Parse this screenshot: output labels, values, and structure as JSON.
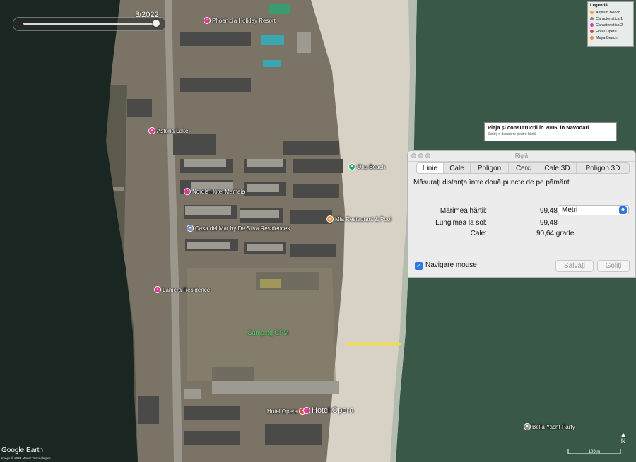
{
  "time_slider": {
    "label": "3/2022",
    "position": 0.95
  },
  "legend": {
    "title": "Legendă",
    "items": [
      {
        "label": "Asylum Beach",
        "color": "#f0a830"
      },
      {
        "label": "Caracteristica 1",
        "color": "#8a8a8a"
      },
      {
        "label": "Caracteristica 2",
        "color": "#d83fb5"
      },
      {
        "label": "Hotel Opera",
        "color": "#e0464d"
      },
      {
        "label": "Maya Beach",
        "color": "#f08a3a"
      }
    ]
  },
  "placemarks": [
    {
      "label": "Phoenicia Holiday Resort",
      "color": "#e0388f"
    },
    {
      "label": "Astoria Lake",
      "color": "#e0388f"
    },
    {
      "label": "Oha Beach",
      "color": "#29a36a"
    },
    {
      "label": "Nordis Hotel Mamaia",
      "color": "#e0388f"
    },
    {
      "label": "Mia Restaurant & Pool",
      "color": "#f08a3a"
    },
    {
      "label": "Casa del Mar by De Silva Residences",
      "color": "#6e87b8"
    },
    {
      "label": "Lamera Residence",
      "color": "#e0388f"
    },
    {
      "label": "Camping CPM",
      "color": "#4cdd6a"
    },
    {
      "label": "Hotel Opera",
      "color": "#e0464d"
    },
    {
      "label": "Hotel Opera",
      "color": "#e0388f"
    },
    {
      "label": "Bella Yacht Party",
      "color": "#8a8a8a"
    }
  ],
  "popup": {
    "title": "Plaja și consutrucții în 2006, în Navodari",
    "description": "Scrieți o descriere pentru hărții."
  },
  "ruler": {
    "window_title": "Riglă",
    "tabs": [
      "Linie",
      "Cale",
      "Poligon",
      "Cerc",
      "Cale 3D",
      "Poligon 3D"
    ],
    "active_tab": "Linie",
    "description": "Măsurați distanța între două puncte de pe pământ",
    "map_length_label": "Mărimea hărții:",
    "map_length_value": "99,48",
    "ground_length_label": "Lungimea la sol:",
    "ground_length_value": "99,48",
    "heading_label": "Cale:",
    "heading_value": "90,64 grade",
    "unit": "Metri",
    "mouse_nav_label": "Navigare mouse",
    "mouse_nav_checked": true,
    "save_label": "Salvați",
    "clear_label": "Goliți"
  },
  "footer": {
    "logo": "Google Earth",
    "credit": "Image © 2024 Maxar Technologies",
    "scale_label": "100 m",
    "north_label": "N",
    "north_icon": "north-arrow"
  },
  "colors": {
    "sea": "#1e2e29",
    "sea_right": "#3b5a4b",
    "sand": "#d8d2c6",
    "measure_line": "#f4e21a"
  }
}
